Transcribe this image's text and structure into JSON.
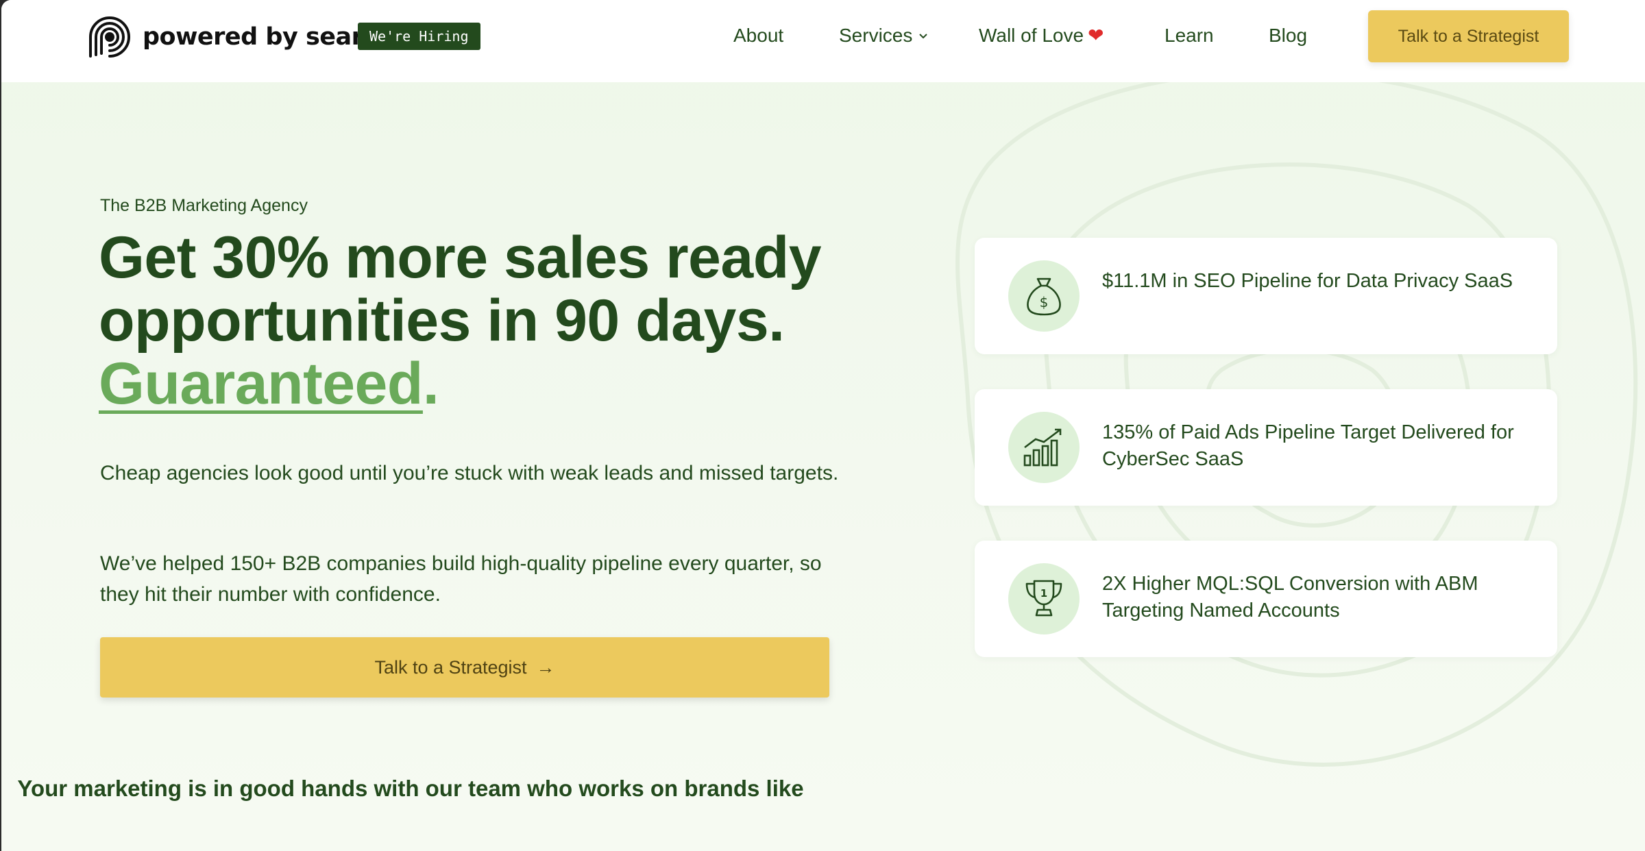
{
  "header": {
    "logo_text": "powered by search",
    "hiring_badge": "We're Hiring",
    "nav": {
      "about": "About",
      "services": "Services",
      "wall_of_love": "Wall of Love",
      "learn": "Learn",
      "blog": "Blog"
    },
    "cta_label": "Talk to a Strategist"
  },
  "hero": {
    "eyebrow": "The B2B Marketing Agency",
    "headline_line1": "Get 30% more sales ready",
    "headline_line2": "opportunities in 90 days.",
    "headline_highlight": "Guaranteed",
    "headline_period": ".",
    "paragraph1": "Cheap agencies look good until you’re stuck with weak leads and missed targets.",
    "paragraph2": "We’ve helped 150+ B2B companies build high-quality pipeline every quarter, so they hit their number with confidence.",
    "cta_label": "Talk to a Strategist",
    "cta_arrow": "→"
  },
  "stats": [
    {
      "icon": "money-bag-icon",
      "text": "$11.1M in SEO Pipeline for Data Privacy SaaS"
    },
    {
      "icon": "growth-chart-icon",
      "text": "135% of Paid Ads Pipeline Target Delivered for CyberSec SaaS"
    },
    {
      "icon": "trophy-icon",
      "text": "2X Higher MQL:SQL Conversion with ABM Targeting Named Accounts"
    }
  ],
  "brands_heading": "Your marketing is in good hands with our team who works on brands like",
  "colors": {
    "brand_dark_green": "#234a1d",
    "accent_green": "#6aaa5a",
    "cta_yellow": "#ecc95d",
    "icon_circle": "#def1d8"
  }
}
